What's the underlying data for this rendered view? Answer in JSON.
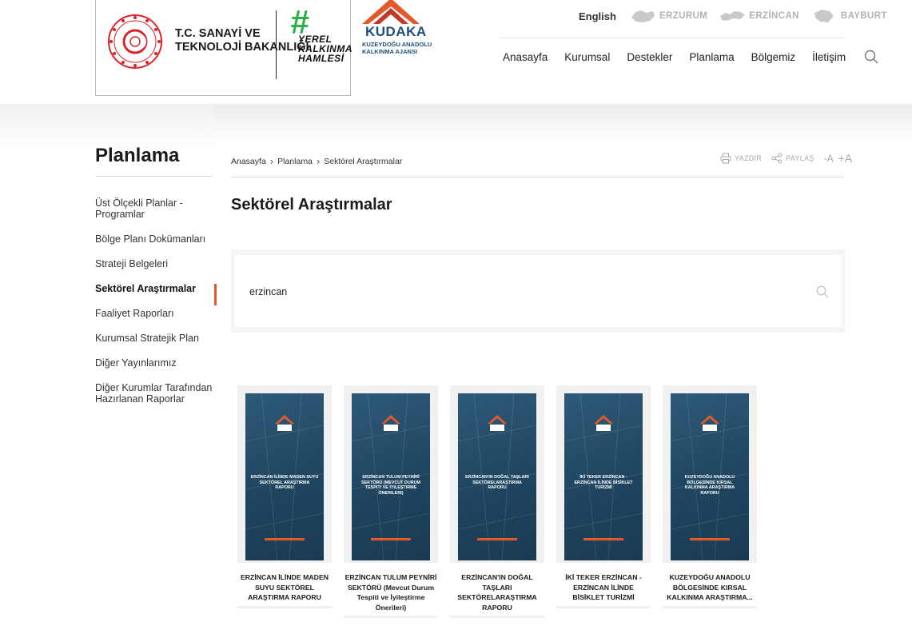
{
  "header": {
    "ministry_line1": "T.C. SANAYİ VE",
    "ministry_line2": "TEKNOLOJİ BAKANLIĞI",
    "hashtag": "#",
    "slogan_line1": "YEREL",
    "slogan_line2": "KALKINMA",
    "slogan_line3": "HAMLESİ",
    "agency_name": "KUDAKA",
    "agency_sub_line1": "KUZEYDOĞU ANADOLU",
    "agency_sub_line2": "KALKINMA AJANSI",
    "language": "English",
    "regions": [
      "ERZURUM",
      "ERZİNCAN",
      "BAYBURT"
    ],
    "nav": [
      "Anasayfa",
      "Kurumsal",
      "Destekler",
      "Planlama",
      "Bölgemiz",
      "İletişim"
    ]
  },
  "sidebar": {
    "title": "Planlama",
    "items": [
      {
        "label": "Üst Ölçekli Planlar - Programlar"
      },
      {
        "label": "Bölge Planı Dokümanları"
      },
      {
        "label": "Strateji Belgeleri"
      },
      {
        "label": "Sektörel Araştırmalar"
      },
      {
        "label": "Faaliyet Raporları"
      },
      {
        "label": "Kurumsal Stratejik Plan"
      },
      {
        "label": "Diğer Yayınlarımız"
      },
      {
        "label": "Diğer Kurumlar Tarafından Hazırlanan Raporlar"
      }
    ],
    "active_index": 3
  },
  "breadcrumb": [
    "Anasayfa",
    "Planlama",
    "Sektörel Araştırmalar"
  ],
  "tools": {
    "print": "YAZDIR",
    "share": "PAYLAŞ",
    "font_smaller": "-A",
    "font_larger": "+A"
  },
  "page": {
    "title": "Sektörel Araştırmalar"
  },
  "search": {
    "value": "erzincan"
  },
  "cards": [
    {
      "cover": "ERZİNCAN İLİNDE MADEN SUYU SEKTÖREL ARAŞTIRMA RAPORU",
      "caption": "ERZİNCAN İLİNDE MADEN SUYU SEKTÖREL ARAŞTIRMA RAPORU"
    },
    {
      "cover": "ERZİNCAN TULUM PEYNİRİ SEKTÖRÜ (Mevcut Durum Tespiti ve İyileştirme Önerileri)",
      "caption": "ERZİNCAN TULUM PEYNİRİ SEKTÖRÜ (Mevcut Durum Tespiti ve İyileştirme Önerileri)"
    },
    {
      "cover": "ERZİNCAN'IN DOĞAL TAŞLARI SEKTÖRELARAŞTIRMA RAPORU",
      "caption": "ERZİNCAN'IN DOĞAL TAŞLARI SEKTÖRELARAŞTIRMA RAPORU"
    },
    {
      "cover": "İKİ TEKER ERZİNCAN - ERZİNCAN İLİNDE BİSİKLET TURİZMİ",
      "caption": "İKİ TEKER ERZİNCAN - ERZİNCAN İLİNDE BİSİKLET TURİZMİ"
    },
    {
      "cover": "KUZEYDOĞU ANADOLU BÖLGESİNDE KIRSAL KALKINMA ARAŞTIRMA RAPORU",
      "caption": "KUZEYDOĞU ANADOLU BÖLGESİNDE KIRSAL KALKINMA ARAŞTIRMA..."
    }
  ],
  "colors": {
    "accent": "#e2592a",
    "cover_blue": "#1f4560",
    "hashtag_green": "#2bb04a",
    "agency_blue": "#1d4f7a"
  }
}
